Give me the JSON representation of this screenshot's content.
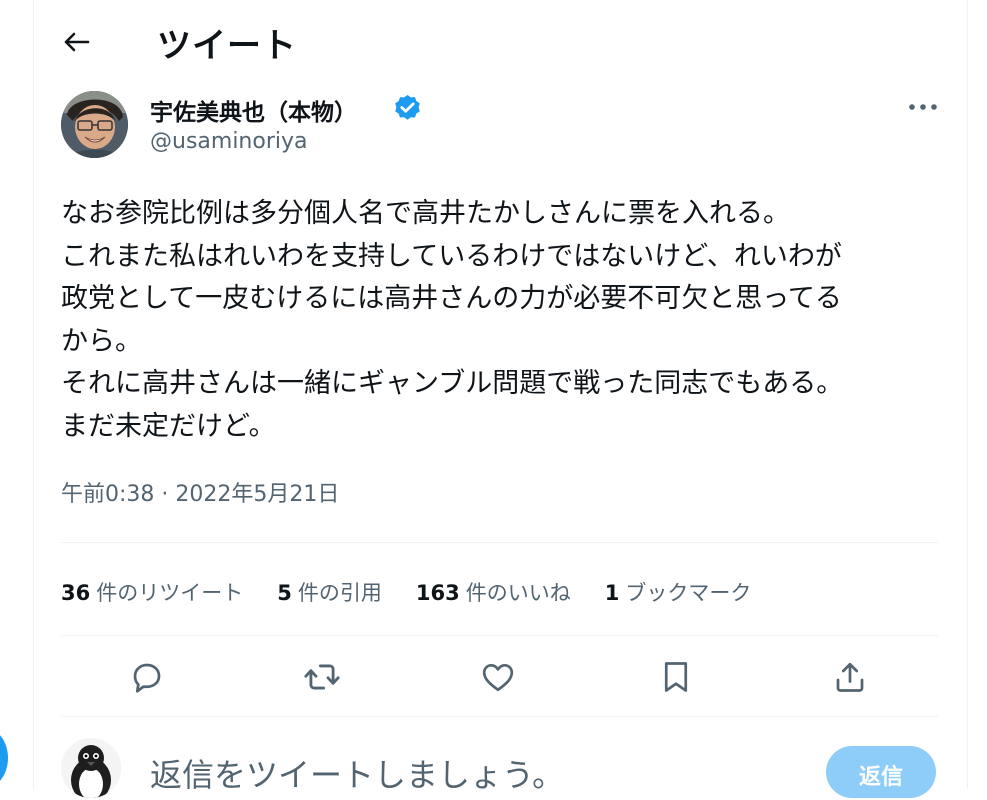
{
  "header": {
    "title": "ツイート"
  },
  "author": {
    "name": "宇佐美典也（本物）",
    "handle": "@usaminoriya"
  },
  "tweet": {
    "text": "なお参院比例は多分個人名で高井たかしさんに票を入れる。\nこれまた私はれいわを支持しているわけではないけど、れいわが\n政党として一皮むけるには高井さんの力が必要不可欠と思ってる\nから。\nそれに高井さんは一緒にギャンブル問題で戦った同志でもある。\nまだ未定だけど。",
    "time": "午前0:38",
    "separator": "·",
    "date": "2022年5月21日"
  },
  "stats": {
    "retweets": {
      "count": "36",
      "label": "件のリツイート"
    },
    "quotes": {
      "count": "5",
      "label": "件の引用"
    },
    "likes": {
      "count": "163",
      "label": "件のいいね"
    },
    "bookmarks": {
      "count": "1",
      "label": "ブックマーク"
    }
  },
  "actions": [
    "reply-icon",
    "retweet-icon",
    "like-icon",
    "bookmark-icon",
    "share-icon"
  ],
  "reply": {
    "placeholder": "返信をツイートしましょう。",
    "button_label": "返信"
  },
  "colors": {
    "accent": "#1d9bf0",
    "reply_button": "#8ecdf8",
    "secondary_text": "#536471",
    "divider": "#eff3f4"
  }
}
